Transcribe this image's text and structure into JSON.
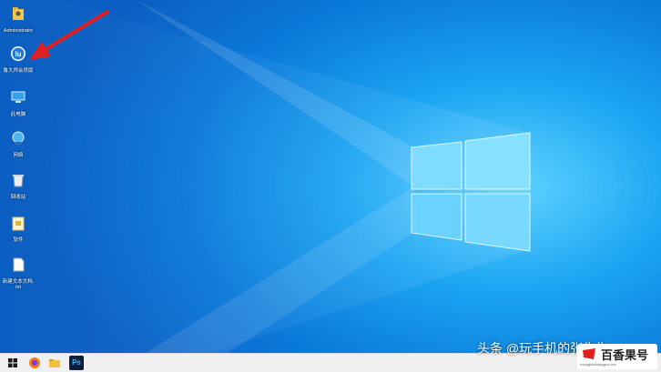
{
  "desktop_icons": [
    {
      "label": "Administrator",
      "icon": "user-folder-icon"
    },
    {
      "label": "鲁大师会员版",
      "icon": "app-shortcut-icon"
    },
    {
      "label": "此电脑",
      "icon": "computer-icon"
    },
    {
      "label": "网络",
      "icon": "network-icon"
    },
    {
      "label": "回收站",
      "icon": "recycle-bin-icon"
    },
    {
      "label": "软件",
      "icon": "folder-icon"
    },
    {
      "label": "新建文本文档.txt",
      "icon": "text-file-icon"
    }
  ],
  "taskbar": {
    "start_icon": "windows-start-icon",
    "apps": [
      "firefox-icon",
      "file-explorer-icon",
      "photoshop-icon"
    ],
    "photoshop_label": "Ps"
  },
  "watermark": "头条 @玩手机的张先生",
  "brand_logo": {
    "text": "百香果号",
    "subtext": "huangjinbaixiangguo.com"
  },
  "colors": {
    "accent_arrow": "#e02020",
    "taskbar_bg": "#f0f0f0"
  }
}
